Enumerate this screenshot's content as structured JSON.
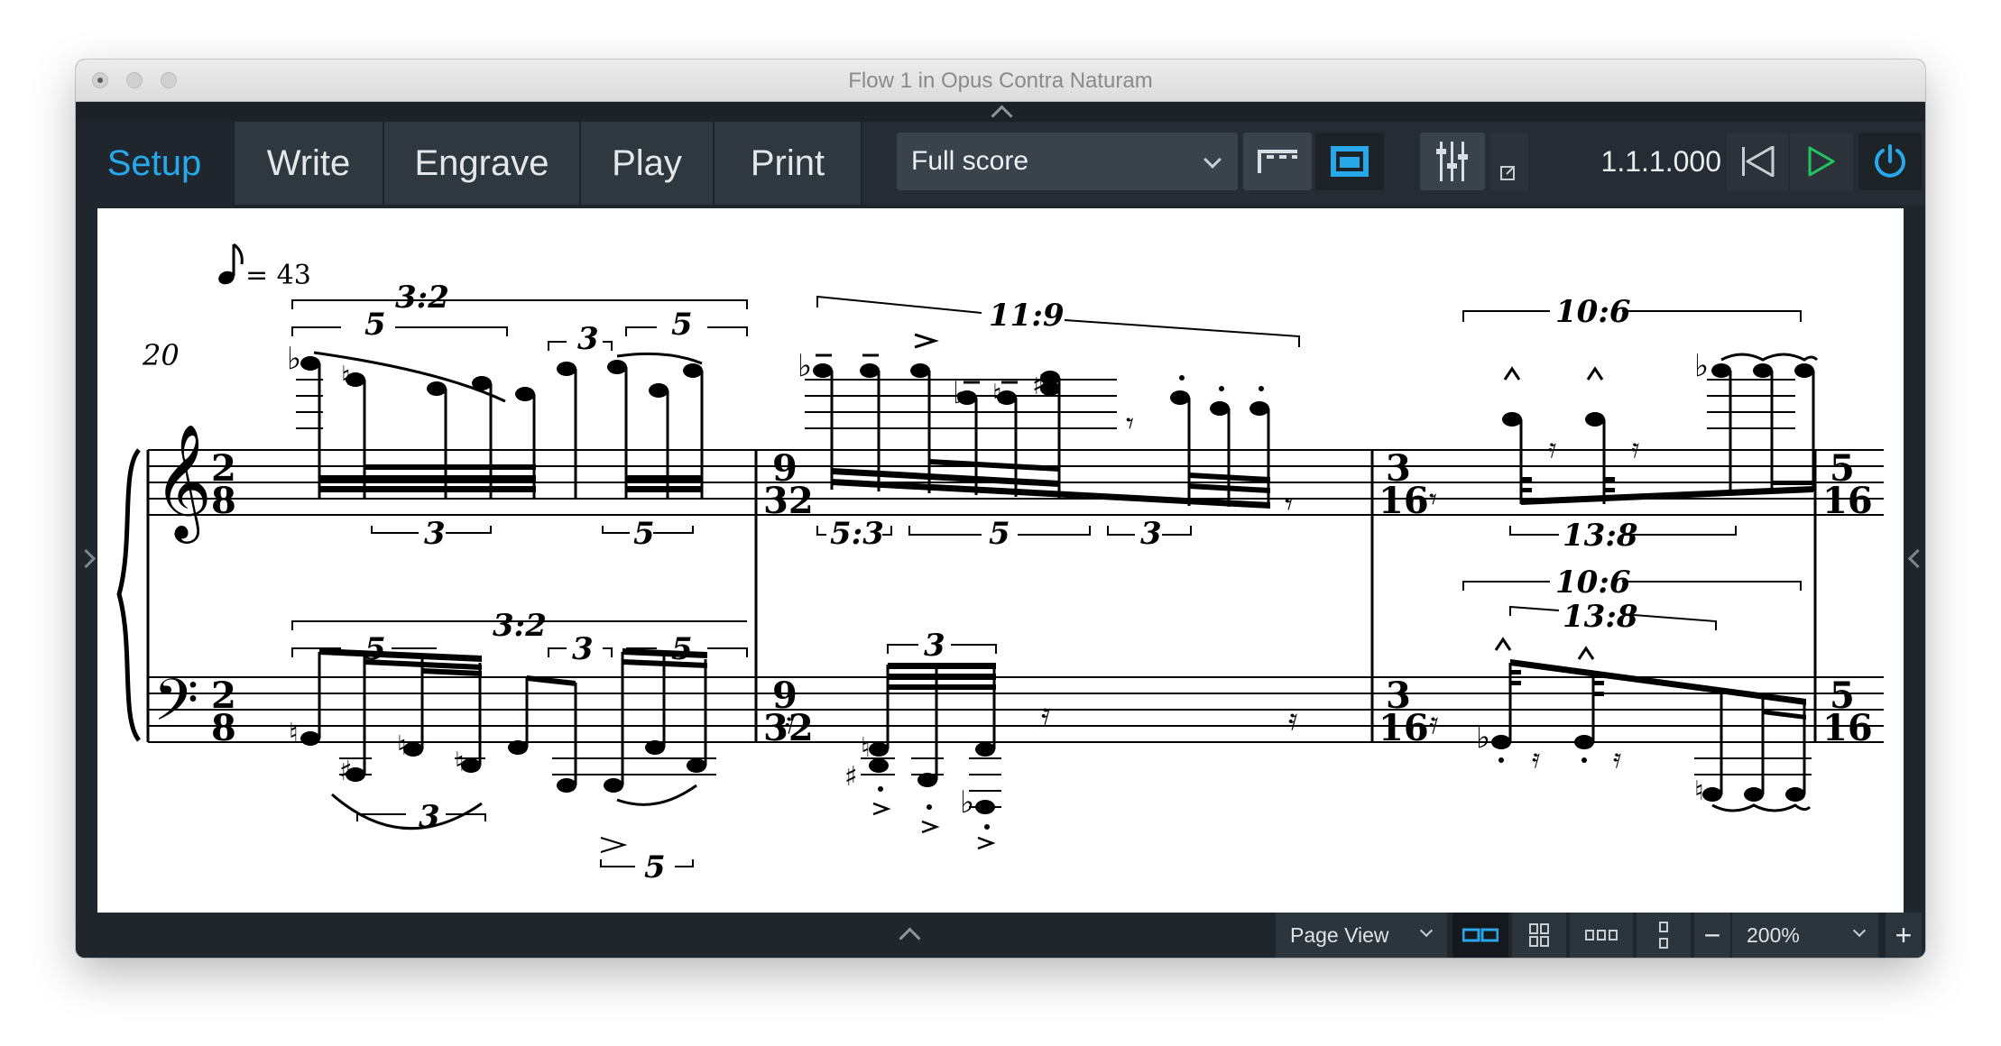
{
  "window": {
    "title": "Flow 1 in Opus Contra Naturam"
  },
  "toolbar": {
    "tabs": [
      {
        "label": "Setup"
      },
      {
        "label": "Write"
      },
      {
        "label": "Engrave"
      },
      {
        "label": "Play"
      },
      {
        "label": "Print"
      }
    ],
    "active_tab": "Setup",
    "layout_select": "Full score",
    "position": "1.1.1.000",
    "accent_color": "#27a8e9",
    "play_color": "#22c55e"
  },
  "score": {
    "tempo": "= 43",
    "bar_number": "20",
    "time_signatures": [
      {
        "num": "2",
        "den": "8"
      },
      {
        "num": "9",
        "den": "32"
      },
      {
        "num": "3",
        "den": "16"
      },
      {
        "num": "5",
        "den": "16"
      }
    ],
    "tuplets_treble": [
      "5",
      "3:2",
      "3",
      "5",
      "11:9",
      "10:6",
      "3",
      "5",
      "5:3",
      "5",
      "3",
      "13:8"
    ],
    "tuplets_bass": [
      "5",
      "3:2",
      "3",
      "5",
      "3",
      "10:6",
      "13:8",
      "3",
      "5"
    ]
  },
  "statusbar": {
    "view_mode": "Page View",
    "zoom": "200%",
    "minus": "−",
    "plus": "+"
  }
}
